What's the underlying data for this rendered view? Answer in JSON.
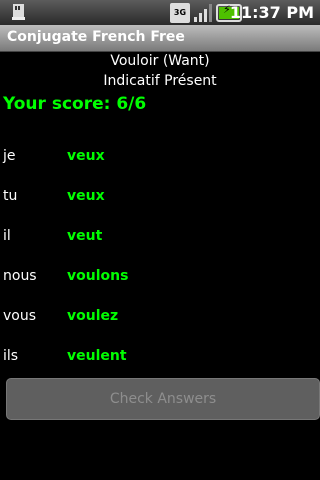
{
  "status_bar": {
    "time": "11:37 PM",
    "network_label": "3G",
    "icons": [
      "sd-card-icon",
      "3g-icon",
      "signal-icon",
      "battery-charging-icon"
    ]
  },
  "app": {
    "title": "Conjugate French Free"
  },
  "verb": {
    "name": "Vouloir (Want)",
    "tense": "Indicatif Présent"
  },
  "score": {
    "text": "Your score: 6/6"
  },
  "conjugations": [
    {
      "pronoun": "je",
      "answer": "veux"
    },
    {
      "pronoun": "tu",
      "answer": "veux"
    },
    {
      "pronoun": "il",
      "answer": "veut"
    },
    {
      "pronoun": "nous",
      "answer": "voulons"
    },
    {
      "pronoun": "vous",
      "answer": "voulez"
    },
    {
      "pronoun": "ils",
      "answer": "veulent"
    }
  ],
  "buttons": {
    "check_answers": "Check Answers"
  },
  "colors": {
    "correct": "#00ff00",
    "background": "#000000"
  }
}
